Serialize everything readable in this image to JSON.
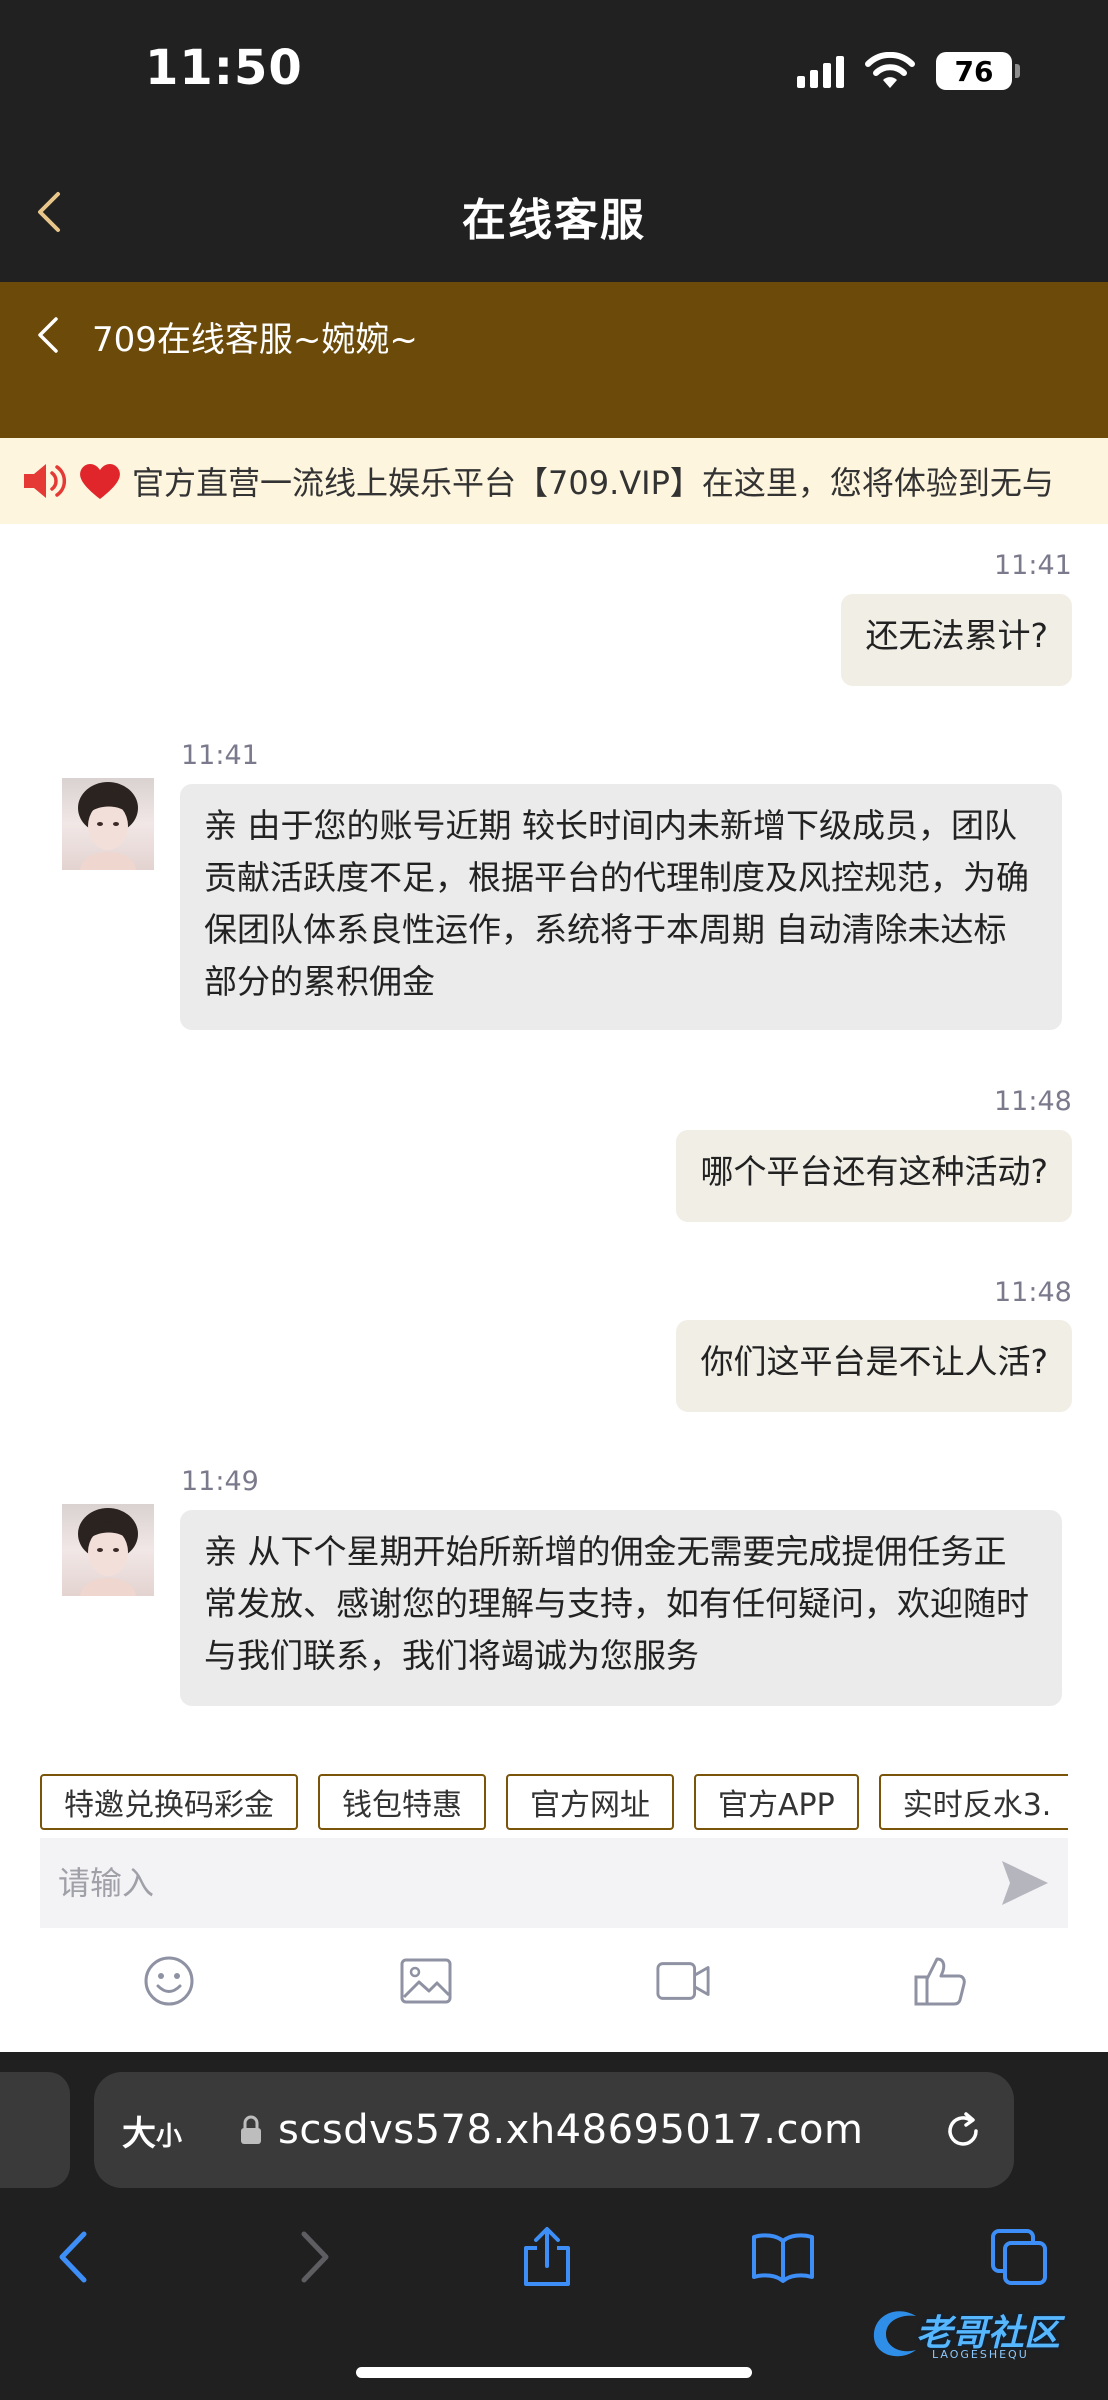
{
  "status_bar": {
    "time": "11:50",
    "battery": "76"
  },
  "app_nav": {
    "title": "在线客服"
  },
  "chat_header": {
    "agent_name": "709在线客服~婉婉~"
  },
  "notice": {
    "text": "官方直营一流线上娱乐平台【709.VIP】在这里，您将体验到无与"
  },
  "messages": [
    {
      "direction": "out",
      "time": "11:41",
      "text": "还无法累计?"
    },
    {
      "direction": "in",
      "time": "11:41",
      "text": "亲 由于您的账号近期 较长时间内未新增下级成员，团队贡献活跃度不足，根据平台的代理制度及风控规范，为确保团队体系良性运作，系统将于本周期 自动清除未达标部分的累积佣金"
    },
    {
      "direction": "out",
      "time": "11:48",
      "text": "哪个平台还有这种活动?"
    },
    {
      "direction": "out",
      "time": "11:48",
      "text": "你们这平台是不让人活?"
    },
    {
      "direction": "in",
      "time": "11:49",
      "text": "亲 从下个星期开始所新增的佣金无需要完成提佣任务正常发放、感谢您的理解与支持，如有任何疑问，欢迎随时与我们联系，我们将竭诚为您服务"
    }
  ],
  "quick_replies": [
    "特邀兑换码彩金",
    "钱包特惠",
    "官方网址",
    "官方APP",
    "实时反水3."
  ],
  "input": {
    "placeholder": "请输入",
    "value": ""
  },
  "toolbar_icons": [
    "emoji-icon",
    "image-icon",
    "video-icon",
    "thumbs-up-icon"
  ],
  "browser": {
    "text_size_label": "大",
    "text_size_small": "小",
    "url": "scsdvs578.xh48695017.com"
  },
  "watermark": {
    "title": "老哥社区",
    "subtitle": "LAOGESHEQU"
  },
  "colors": {
    "header_bg": "#6b4a0a",
    "notice_bg": "#fdf5de",
    "chip_border": "#7a5408",
    "accent_blue": "#3e8ef7"
  }
}
